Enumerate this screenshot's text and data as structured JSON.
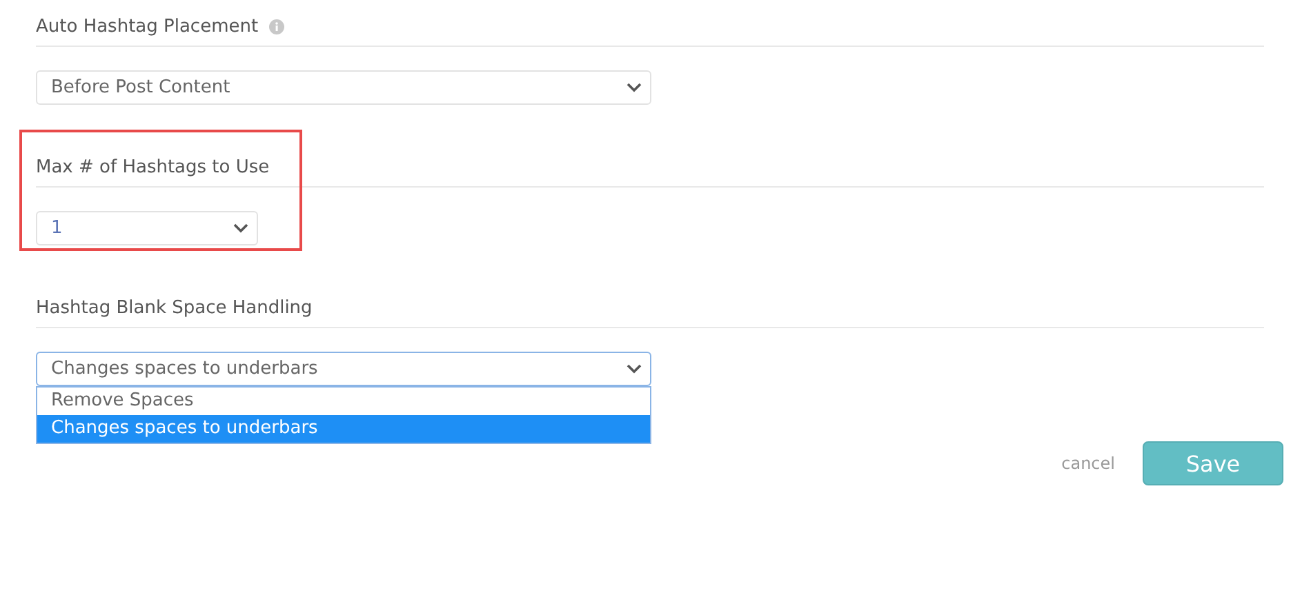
{
  "sections": [
    {
      "title": "Auto Hashtag Placement",
      "info": true,
      "select": {
        "kind": "wide",
        "value": "Before Post Content",
        "open": false
      }
    },
    {
      "title": "Max # of Hashtags to Use",
      "highlighted": true,
      "select": {
        "kind": "short",
        "value": "1",
        "open": false
      }
    },
    {
      "title": "Hashtag Blank Space Handling",
      "select": {
        "kind": "wide",
        "value": "Changes spaces to underbars",
        "open": true,
        "options": [
          {
            "label": "Remove Spaces",
            "selected": false
          },
          {
            "label": "Changes spaces to underbars",
            "selected": true
          }
        ]
      }
    }
  ],
  "actions": {
    "cancel": "cancel",
    "save": "Save"
  }
}
